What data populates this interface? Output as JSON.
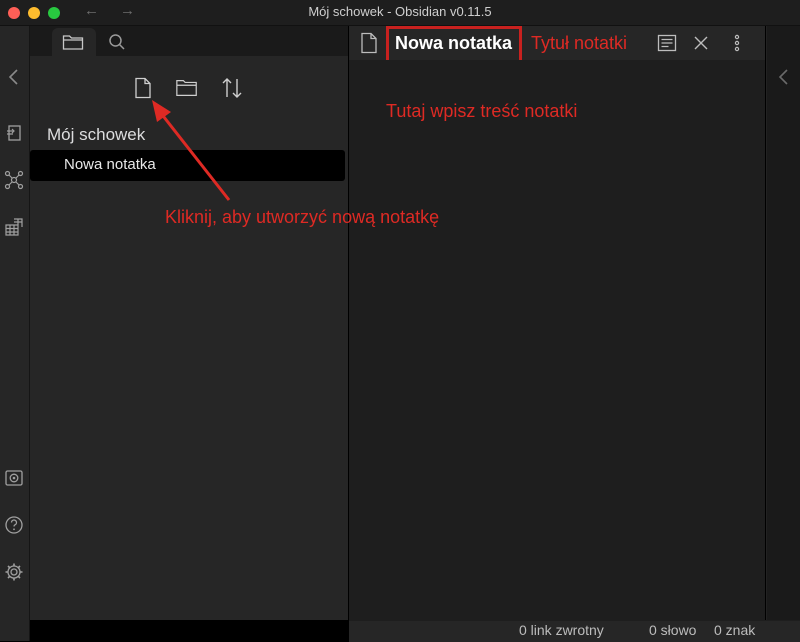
{
  "window": {
    "title": "Mój schowek - Obsidian v0.11.5",
    "back_arrow": "←",
    "forward_arrow": "→"
  },
  "ribbon": {
    "collapse_icon": "chevron-left-icon",
    "icons": [
      "quick-switcher-icon",
      "graph-view-icon",
      "plugins-grid-icon",
      "vault-icon",
      "help-icon",
      "settings-icon"
    ]
  },
  "sidebar": {
    "tabs": [
      "folder-icon",
      "search-icon"
    ],
    "toolbar": [
      "new-note-icon",
      "new-folder-icon",
      "sort-icon"
    ],
    "vault_name": "Mój schowek",
    "files": [
      {
        "label": "Nowa notatka",
        "active": true
      }
    ]
  },
  "editor": {
    "file_icon": "file-icon",
    "title": "Nowa notatka",
    "actions": [
      "reading-view-icon",
      "close-icon",
      "more-options-icon"
    ]
  },
  "statusbar": {
    "backlinks": "0 link zwrotny",
    "words": "0 słowo",
    "chars": "0 znak"
  },
  "annotations": {
    "title_hint": "Tytuł notatki",
    "content_hint": "Tutaj wpisz treść notatki",
    "new_note_hint": "Kliknij, aby utworzyć nową notatkę",
    "color": "#de2a24"
  }
}
